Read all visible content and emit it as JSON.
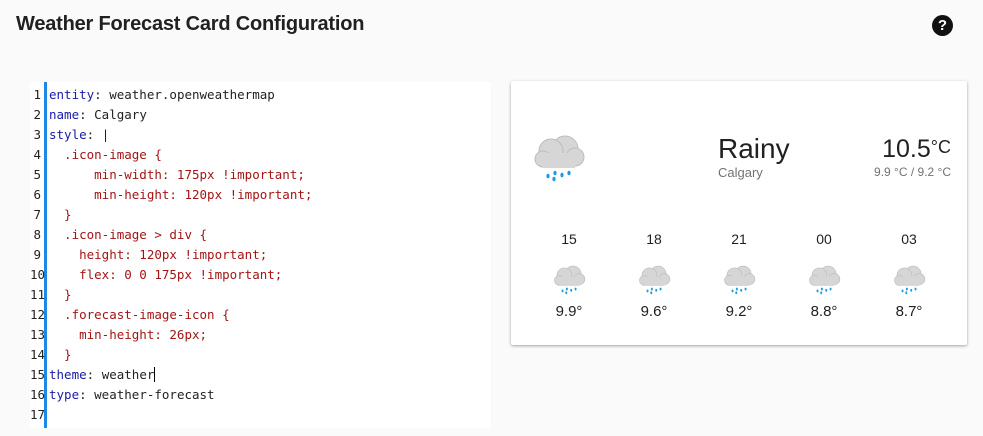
{
  "header": {
    "title": "Weather Forecast Card Configuration",
    "help_icon": "help-circle-icon"
  },
  "editor": {
    "lines": [
      [
        {
          "t": "entity",
          "c": "k"
        },
        {
          "t": ": weather.openweathermap",
          "c": ""
        }
      ],
      [
        {
          "t": "name",
          "c": "k"
        },
        {
          "t": ": Calgary",
          "c": ""
        }
      ],
      [
        {
          "t": "style",
          "c": "k"
        },
        {
          "t": ": |",
          "c": ""
        }
      ],
      [
        {
          "t": "  .icon-image {",
          "c": "s"
        }
      ],
      [
        {
          "t": "      min-width: 175px !important;",
          "c": "s"
        }
      ],
      [
        {
          "t": "      min-height: 120px !important;",
          "c": "s"
        }
      ],
      [
        {
          "t": "  }",
          "c": "s"
        }
      ],
      [
        {
          "t": "  .icon-image > div {",
          "c": "s"
        }
      ],
      [
        {
          "t": "    height: 120px !important;",
          "c": "s"
        }
      ],
      [
        {
          "t": "    flex: 0 0 175px !important;",
          "c": "s"
        }
      ],
      [
        {
          "t": "  }",
          "c": "s"
        }
      ],
      [
        {
          "t": "  .forecast-image-icon {",
          "c": "s"
        }
      ],
      [
        {
          "t": "    min-height: 26px;",
          "c": "s"
        }
      ],
      [
        {
          "t": "  }",
          "c": "s"
        }
      ],
      [
        {
          "t": "theme",
          "c": "k"
        },
        {
          "t": ": weather",
          "c": ""
        },
        {
          "t": "",
          "c": "cursor"
        }
      ],
      [
        {
          "t": "type",
          "c": "k"
        },
        {
          "t": ": weather-forecast",
          "c": ""
        }
      ],
      []
    ]
  },
  "weather": {
    "condition": "Rainy",
    "location": "Calgary",
    "temperature": "10.5",
    "unit": "°C",
    "hilo": "9.9 °C / 9.2 °C",
    "icon": "rainy-cloud-icon",
    "forecast": [
      {
        "time": "15",
        "temp": "9.9°"
      },
      {
        "time": "18",
        "temp": "9.6°"
      },
      {
        "time": "21",
        "temp": "9.2°"
      },
      {
        "time": "00",
        "temp": "8.8°"
      },
      {
        "time": "03",
        "temp": "8.7°"
      }
    ]
  },
  "colors": {
    "accent": "#1e88e5",
    "key": "#1a1aa6",
    "string": "#a31515",
    "rain": "#1e9be3"
  }
}
